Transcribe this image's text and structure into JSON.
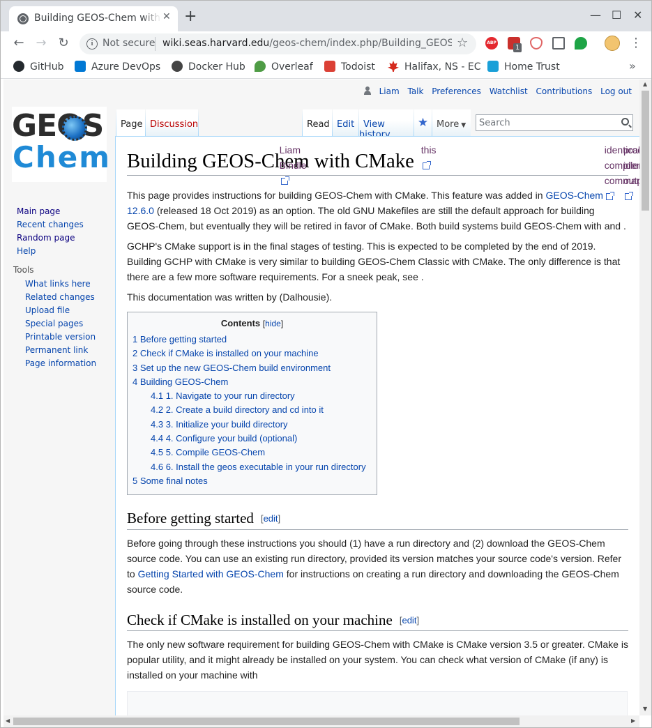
{
  "browser": {
    "tab_title": "Building GEOS-Chem with CMake",
    "tab_close": "✕",
    "new_tab": "+",
    "window_minimize": "—",
    "window_maximize": "☐",
    "window_close": "✕",
    "security_label": "Not secure",
    "url_host": "wiki.seas.harvard.edu",
    "url_path": "/geos-chem/index.php/Building_GEOS_Ch...",
    "extension_badge": "1",
    "abp_label": "ABP",
    "bookmarks": [
      {
        "label": "GitHub",
        "color": "#24292e"
      },
      {
        "label": "Azure DevOps",
        "color": "#0078d4"
      },
      {
        "label": "Docker Hub",
        "color": "#444444"
      },
      {
        "label": "Overleaf",
        "color": "#4f9c45"
      },
      {
        "label": "Todoist",
        "color": "#db4035"
      },
      {
        "label": "Halifax, NS - EC",
        "color": "#d52b1e"
      },
      {
        "label": "Home Trust",
        "color": "#1aa0d8"
      }
    ],
    "bookmarks_more": "»"
  },
  "wiki": {
    "personal": {
      "user": "Liam",
      "talk": "Talk",
      "preferences": "Preferences",
      "watchlist": "Watchlist",
      "contributions": "Contributions",
      "logout": "Log out"
    },
    "logo": {
      "geos": "GEOS",
      "chem": "Chem"
    },
    "nav": {
      "main_page": "Main page",
      "recent_changes": "Recent changes",
      "random_page": "Random page",
      "help": "Help"
    },
    "tools_heading": "Tools",
    "tools": [
      "What links here",
      "Related changes",
      "Upload file",
      "Special pages",
      "Printable version",
      "Permanent link",
      "Page information"
    ],
    "tabs": {
      "page": "Page",
      "discussion": "Discussion",
      "read": "Read",
      "edit": "Edit",
      "view_history": "View history",
      "more": "More"
    },
    "search_placeholder": "Search",
    "article": {
      "title": "Building GEOS-Chem with CMake",
      "p1_a": "This page provides instructions for building GEOS-Chem with CMake. This feature was added in ",
      "p1_link": "GEOS-Chem 12.6.0",
      "p1_b": " (released 18 Oct 2019) as an option. The old GNU Makefiles are still the default approach for building GEOS-Chem, but eventually they will be retired in favor of CMake. Both build systems build GEOS-Chem with ",
      "p1_ext1": "identical compiler commands",
      "p1_c": " and ",
      "p1_ext2": "produce identical output",
      "p1_d": ".",
      "p2_a": "GCHP's CMake support is in the final stages of testing. This is expected to be completed by the end of 2019. Building GCHP with CMake is very similar to building GEOS-Chem Classic with CMake. The only difference is that there are a few more software requirements. For a sneek peak, see ",
      "p2_ext": "this",
      "p2_b": ".",
      "p3_a": "This documentation was written by ",
      "p3_ext": "Liam Bindle",
      "p3_b": " (Dalhousie).",
      "toc_title": "Contents",
      "toc_hide_open": "[",
      "toc_hide": "hide",
      "toc_hide_close": "]",
      "toc": [
        {
          "num": "1",
          "text": "Before getting started",
          "sub": false
        },
        {
          "num": "2",
          "text": "Check if CMake is installed on your machine",
          "sub": false
        },
        {
          "num": "3",
          "text": "Set up the new GEOS-Chem build environment",
          "sub": false
        },
        {
          "num": "4",
          "text": "Building GEOS-Chem",
          "sub": false
        },
        {
          "num": "4.1",
          "text": "1. Navigate to your run directory",
          "sub": true
        },
        {
          "num": "4.2",
          "text": "2. Create a build directory and cd into it",
          "sub": true
        },
        {
          "num": "4.3",
          "text": "3. Initialize your build directory",
          "sub": true
        },
        {
          "num": "4.4",
          "text": "4. Configure your build (optional)",
          "sub": true
        },
        {
          "num": "4.5",
          "text": "5. Compile GEOS-Chem",
          "sub": true
        },
        {
          "num": "4.6",
          "text": "6. Install the geos executable in your run directory",
          "sub": true
        },
        {
          "num": "5",
          "text": "Some final notes",
          "sub": false
        }
      ],
      "h2_1": "Before getting started",
      "edit_label": "edit",
      "s1_a": "Before going through these instructions you should (1) have a run directory and (2) download the GEOS-Chem source code. You can use an existing run directory, provided its version matches your source code's version. Refer to ",
      "s1_link": "Getting Started with GEOS-Chem",
      "s1_b": " for instructions on creating a run directory and downloading the GEOS-Chem source code.",
      "h2_2": "Check if CMake is installed on your machine",
      "s2": "The only new software requirement for building GEOS-Chem with CMake is CMake version 3.5 or greater. CMake is popular utility, and it might already be installed on your system. You can check what version of CMake (if any) is installed on your machine with"
    }
  }
}
